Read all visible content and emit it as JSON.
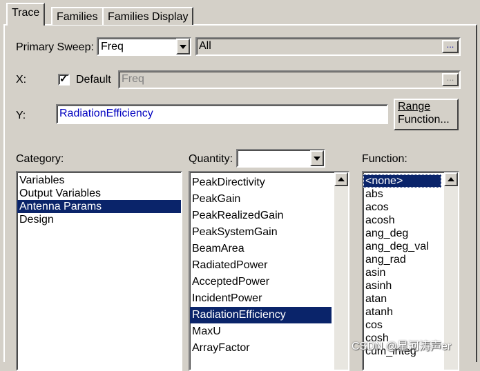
{
  "tabs": [
    "Trace",
    "Families",
    "Families Display"
  ],
  "primary_sweep": {
    "label": "Primary Sweep:",
    "value": "Freq",
    "all_value": "All",
    "dots": "..."
  },
  "x": {
    "label": "X:",
    "default_label": "Default",
    "default_checked": true,
    "value": "Freq",
    "dots": "..."
  },
  "y": {
    "label": "Y:",
    "value": "RadiationEfficiency",
    "range_function_button": [
      "Range",
      "Function..."
    ]
  },
  "category": {
    "label": "Category:",
    "items": [
      "Variables",
      "Output Variables",
      "Antenna Params",
      "Design"
    ],
    "selected": "Antenna Params"
  },
  "quantity": {
    "label": "Quantity:",
    "filter_value": "",
    "items": [
      "PeakDirectivity",
      "PeakGain",
      "PeakRealizedGain",
      "PeakSystemGain",
      "BeamArea",
      "RadiatedPower",
      "AcceptedPower",
      "IncidentPower",
      "RadiationEfficiency",
      "MaxU",
      "ArrayFactor"
    ],
    "selected": "RadiationEfficiency"
  },
  "function": {
    "label": "Function:",
    "items": [
      "<none>",
      "abs",
      "acos",
      "acosh",
      "ang_deg",
      "ang_deg_val",
      "ang_rad",
      "asin",
      "asinh",
      "atan",
      "atanh",
      "cos",
      "cosh",
      "cum_integ"
    ],
    "selected": "<none>"
  },
  "watermark": "CSDN @星河涛声er",
  "colors": {
    "face": "#d4d0c8",
    "selection": "#0a246a",
    "value_text": "#0000c0"
  }
}
